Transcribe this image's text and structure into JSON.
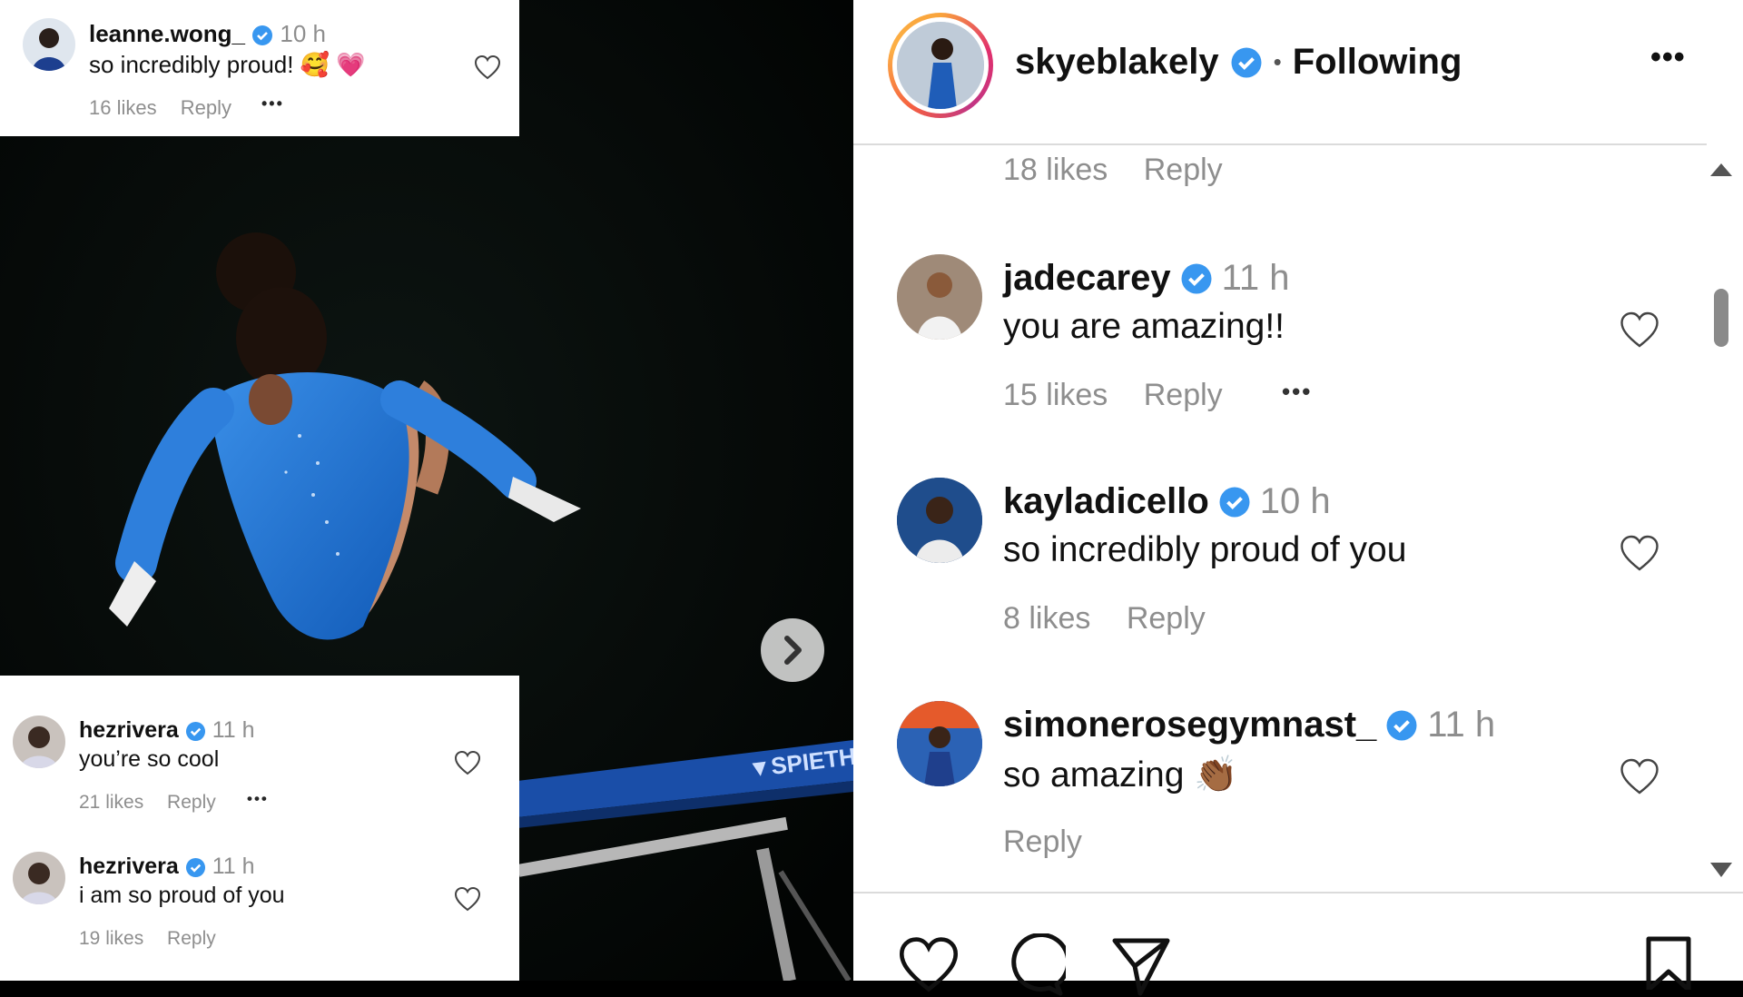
{
  "left": {
    "top_comment": {
      "user": "leanne.wong_",
      "time": "10 h",
      "text": "so incredibly proud!",
      "emoji": "🥰 💗",
      "likes": "16 likes",
      "reply": "Reply",
      "more": "•••"
    },
    "next_button_icon": "chevron-right-icon",
    "bottom_comments": [
      {
        "user": "hezrivera",
        "time": "11 h",
        "text": "you’re so cool",
        "likes": "21 likes",
        "reply": "Reply",
        "more": "•••"
      },
      {
        "user": "hezrivera",
        "time": "11 h",
        "text": "i am so proud of you",
        "likes": "19 likes",
        "reply": "Reply"
      }
    ]
  },
  "panel": {
    "header": {
      "user": "skyeblakely",
      "separator": "•",
      "following": "Following",
      "more": "•••"
    },
    "partial": {
      "likes": "18 likes",
      "reply": "Reply"
    },
    "comments": [
      {
        "user": "jadecarey",
        "time": "11 h",
        "text": "you are amazing!!",
        "likes": "15 likes",
        "reply": "Reply",
        "more": "•••"
      },
      {
        "user": "kayladicello",
        "time": "10 h",
        "text": "so incredibly proud of you",
        "likes": "8 likes",
        "reply": "Reply"
      },
      {
        "user": "simonerosegymnast_",
        "time": "11 h",
        "text": "so amazing",
        "emoji": "👏🏾",
        "reply": "Reply"
      }
    ],
    "actions": [
      "like-icon",
      "comment-icon",
      "share-icon",
      "save-icon"
    ]
  },
  "colors": {
    "verified": "#3897f0",
    "muted": "#8e8e8e",
    "heart_pink": "#ed4956",
    "leotard": "#1f6fd1"
  }
}
